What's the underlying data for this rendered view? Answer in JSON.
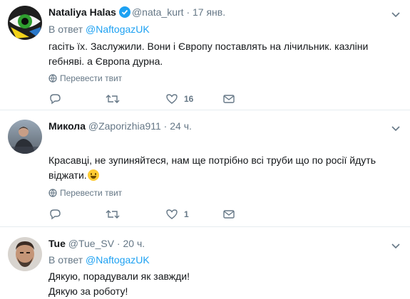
{
  "tweets": [
    {
      "name": "Nataliya Halas",
      "handle": "@nata_kurt",
      "dot": "·",
      "time": "17 янв.",
      "verified": true,
      "reply_prefix": "В ответ",
      "reply_to": "@NaftogazUK",
      "text": "гасіть їх. Заслужили. Вони і Європу поставлять на лічильник. казліни гебняві. а Європа дурна.",
      "translate": "Перевести твит",
      "likes": "16"
    },
    {
      "name": "Микола",
      "handle": "@Zaporizhia911",
      "dot": "·",
      "time": "24 ч.",
      "verified": false,
      "text": "Красавці, не зупиняйтеся, нам ще потрібно всі труби що по росії йдуть віджати.",
      "translate": "Перевести твит",
      "likes": "1"
    },
    {
      "name": "Tue",
      "handle": "@Tue_SV",
      "dot": "·",
      "time": "20 ч.",
      "verified": false,
      "reply_prefix": "В ответ",
      "reply_to": "@NaftogazUK",
      "text_line1": "Дякую, порадували як завжди!",
      "text_line2": "Дякую за роботу!"
    }
  ],
  "colors": {
    "accent": "#1da1f2",
    "muted": "#657786",
    "divider": "#e6ecf0"
  },
  "icons": [
    "verified-icon",
    "caret-down-icon",
    "globe-icon",
    "reply-icon",
    "retweet-icon",
    "like-icon",
    "message-icon",
    "smile-emoji"
  ]
}
